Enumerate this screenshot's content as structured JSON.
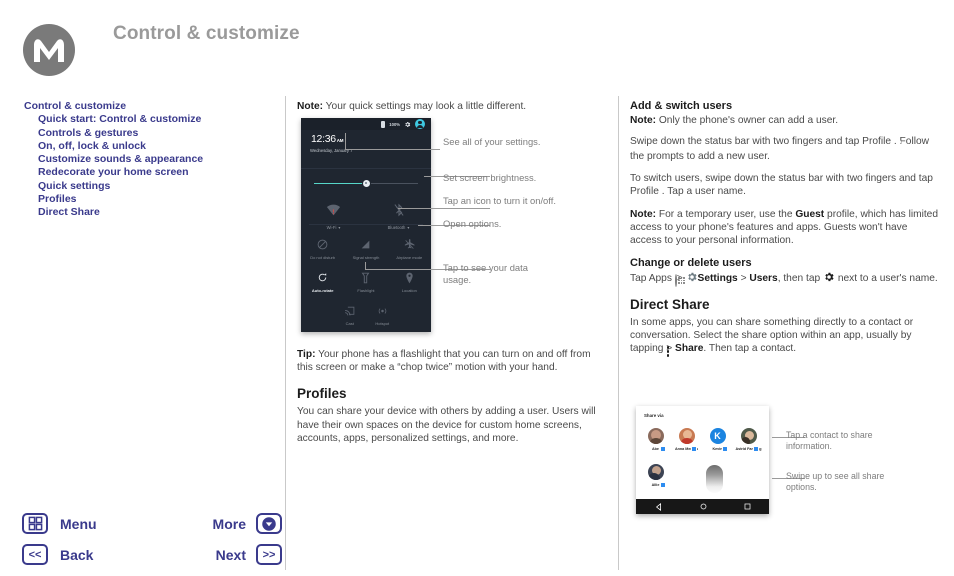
{
  "header": {
    "title": "Control & customize",
    "logo_icon": "motorola-logo-icon"
  },
  "sidebar": {
    "items": [
      {
        "label": "Control & customize",
        "level": 0
      },
      {
        "label": "Quick start: Control & customize",
        "level": 1
      },
      {
        "label": "Controls & gestures",
        "level": 1
      },
      {
        "label": "On, off, lock & unlock",
        "level": 1
      },
      {
        "label": "Customize sounds & appearance",
        "level": 1
      },
      {
        "label": "Redecorate your home screen",
        "level": 1
      },
      {
        "label": "Quick settings",
        "level": 1
      },
      {
        "label": "Profiles",
        "level": 1
      },
      {
        "label": "Direct Share",
        "level": 1
      }
    ]
  },
  "middle": {
    "note_label": "Note:",
    "note_text": " Your quick settings may look a little different.",
    "tip_label": "Tip:",
    "tip_text": " Your phone has a flashlight that you can turn on and off from this screen or make a “chop twice” motion with your hand.",
    "profiles_heading": "Profiles",
    "profiles_text": "You can share your device with others by adding a user. Users will have their own spaces on the device for custom home screens, accounts, apps, personalized settings, and more."
  },
  "quick_settings_shot": {
    "status_battery": "100%",
    "status_gear_icon": "gear-icon",
    "status_avatar_icon": "profile-avatar-icon",
    "time": "12:36",
    "time_meridiem": "AM",
    "date": "Wednesday, January 7",
    "brightness_percent": 50,
    "big_tiles": [
      {
        "label": "Wi-Fi",
        "icon": "wifi-icon",
        "caret": "▾"
      },
      {
        "label": "Bluetooth",
        "icon": "bluetooth-off-icon",
        "caret": "▾"
      }
    ],
    "tiles": [
      {
        "label": "Do not disturb",
        "icon": "do-not-disturb-icon",
        "on": false
      },
      {
        "label": "Signal strength",
        "icon": "signal-strength-icon",
        "on": false
      },
      {
        "label": "Airplane mode",
        "icon": "airplane-mode-icon",
        "on": false
      },
      {
        "label": "Auto-rotate",
        "icon": "auto-rotate-icon",
        "on": true
      },
      {
        "label": "Flashlight",
        "icon": "flashlight-icon",
        "on": false
      },
      {
        "label": "Location",
        "icon": "location-pin-icon",
        "on": false
      },
      {
        "label": "Cast",
        "icon": "cast-icon",
        "on": false
      },
      {
        "label": "Hotspot",
        "icon": "hotspot-icon",
        "on": false
      }
    ]
  },
  "callouts": [
    {
      "text": "See all of your settings."
    },
    {
      "text": "Set screen brightness."
    },
    {
      "text": "Tap an icon to turn it on/off."
    },
    {
      "text": "Open options."
    },
    {
      "text": "Tap to see your data usage."
    }
  ],
  "right": {
    "add_switch_heading": "Add & switch users",
    "note1_label": "Note:",
    "note1_text": " Only the phone's owner can add a user.",
    "para1_a": "Swipe down the status bar with two fingers and tap Profile ",
    "para1_b": ". Follow the prompts to add a new user.",
    "para2_a": "To switch users, swipe down the status bar with two fingers and tap Profile ",
    "para2_b": ". Tap a user name.",
    "note2_label": "Note:",
    "note2_a": " For a temporary user, use the ",
    "note2_guest": "Guest",
    "note2_b": " profile, which has limited access to your phone's features and apps. Guests won't have access to your personal information.",
    "change_heading": "Change or delete users",
    "change_a": "Tap Apps ",
    "change_b": " > ",
    "change_settings": "Settings",
    "change_c": " > ",
    "change_users": "Users",
    "change_d": ", then tap ",
    "change_e": " next to a user's name.",
    "direct_share_heading": "Direct Share",
    "direct_share_a": "In some apps, you can share something directly to a contact or conversation. Select the share option within an app, usually by tapping ",
    "direct_share_b": " > ",
    "direct_share_share": "Share",
    "direct_share_c": ". Then tap a contact."
  },
  "share_shot": {
    "title": "Share via",
    "contacts_row1": [
      {
        "name": "Abe",
        "avatar_color": "#8a6a5c"
      },
      {
        "name": "Anna Medina",
        "avatar_color": "#c87a52"
      },
      {
        "name": "Kevin",
        "avatar_color": "#1b84e0",
        "initial": "K"
      },
      {
        "name": "Astrid Fanning",
        "avatar_color": "#4f5a4a"
      }
    ],
    "contacts_row2": [
      {
        "name": "Allie",
        "avatar_color": "#3d4454"
      }
    ],
    "nav_back_icon": "back-triangle-icon",
    "nav_home_icon": "home-circle-icon",
    "nav_recents_icon": "recents-square-icon"
  },
  "share_callouts": [
    {
      "text": "Tap a contact to share information."
    },
    {
      "text": "Swipe up to see all share options."
    }
  ],
  "footer": {
    "menu_label": "Menu",
    "menu_icon": "menu-grid-icon",
    "back_label": "Back",
    "back_icon": "back-chevrons-icon",
    "more_label": "More",
    "more_icon": "more-down-icon",
    "next_label": "Next",
    "next_icon": "next-chevrons-icon"
  },
  "colors": {
    "nav_blue": "#3a3a8c",
    "title_gray": "#9a9a9a",
    "accent_cyan": "#3ec8e0",
    "phone_bg": "#1f2630",
    "slider_teal": "#56d6c8"
  }
}
